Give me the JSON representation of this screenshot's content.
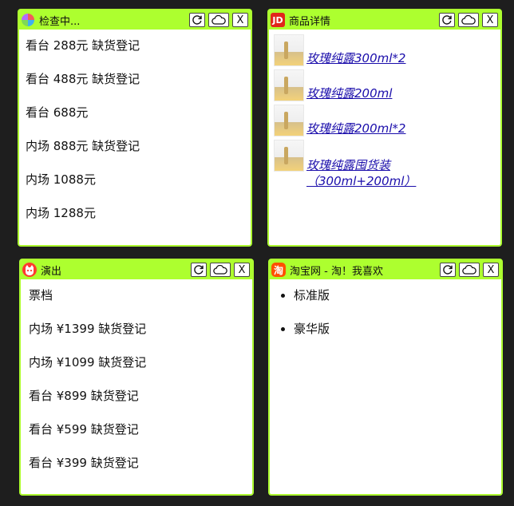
{
  "panels": [
    {
      "title": "检查中...",
      "icon": "pinwheel-icon",
      "lines": [
        "看台 288元 缺货登记",
        "看台 488元 缺货登记",
        "看台 688元",
        "内场 888元 缺货登记",
        "内场 1088元",
        "内场 1288元"
      ]
    },
    {
      "title": "商品详情",
      "icon": "jd-logo-icon",
      "icon_text": "JD",
      "products": [
        "玫瑰纯露300ml*2",
        "玫瑰纯露200ml",
        "玫瑰纯露200ml*2",
        "玫瑰纯露囤货装（300ml+200ml）"
      ]
    },
    {
      "title": "演出",
      "icon": "cat-face-icon",
      "lines": [
        "票档",
        "内场 ¥1399 缺货登记",
        "内场 ¥1099 缺货登记",
        "看台 ¥899 缺货登记",
        "看台 ¥599 缺货登记",
        "看台 ¥399 缺货登记"
      ]
    },
    {
      "title": "淘宝网 - 淘！我喜欢",
      "icon": "taobao-logo-icon",
      "icon_text": "淘",
      "items": [
        "标准版",
        "豪华版"
      ]
    }
  ],
  "buttons": {
    "refresh": "refresh-icon",
    "cloud": "cloud-icon",
    "close": "X"
  },
  "colors": {
    "accent": "#adff2f",
    "background": "#1e1e1e",
    "jd_red": "#e1251b",
    "taobao_orange": "#ff5000",
    "link": "#1a0dab"
  }
}
